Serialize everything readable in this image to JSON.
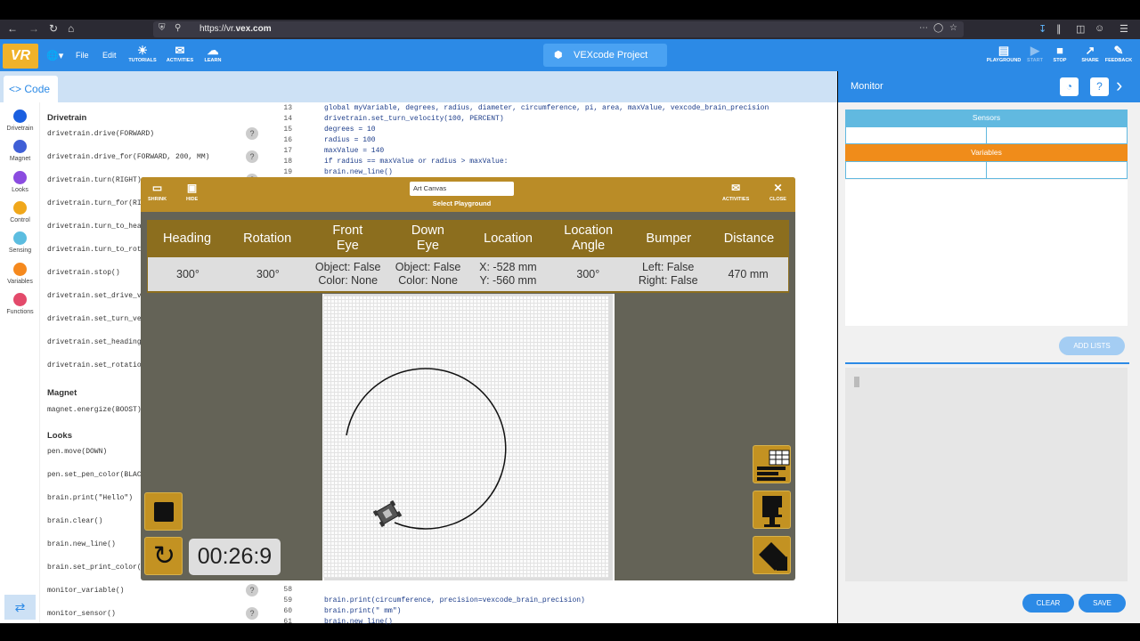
{
  "browser": {
    "url_prefix": "https://vr.",
    "url_domain": "vex.com"
  },
  "header": {
    "logo": "VR",
    "menu_file": "File",
    "menu_edit": "Edit",
    "tutorials": "TUTORIALS",
    "activities": "ACTIVITIES",
    "learn": "LEARN",
    "project_name": "VEXcode Project",
    "playground": "PLAYGROUND",
    "start": "START",
    "stop": "STOP",
    "share": "SHARE",
    "feedback": "FEEDBACK"
  },
  "code_tab": {
    "label": "Code"
  },
  "categories": [
    "Drivetrain",
    "Magnet",
    "Looks",
    "Control",
    "Sensing",
    "Variables",
    "Functions"
  ],
  "category_colors": [
    "#1a5fe0",
    "#3f5fd6",
    "#8b4ce0",
    "#f0a71b",
    "#5cbde0",
    "#f5891e",
    "#e34a6b"
  ],
  "blocks": {
    "drivetrain_title": "Drivetrain",
    "drivetrain": [
      "drivetrain.drive(FORWARD)",
      "drivetrain.drive_for(FORWARD, 200, MM)",
      "drivetrain.turn(RIGHT)",
      "drivetrain.turn_for(RI",
      "drivetrain.turn_to_hea",
      "drivetrain.turn_to_rot",
      "drivetrain.stop()",
      "drivetrain.set_drive_v",
      "drivetrain.set_turn_ve",
      "drivetrain.set_heading",
      "drivetrain.set_rotatio"
    ],
    "magnet_title": "Magnet",
    "magnet": [
      "magnet.energize(BOOST)"
    ],
    "looks_title": "Looks",
    "looks": [
      "pen.move(DOWN)",
      "pen.set_pen_color(BLAC",
      "brain.print(\"Hello\")",
      "brain.clear()",
      "brain.new_line()",
      "brain.set_print_color(",
      "monitor_variable()",
      "monitor_sensor()"
    ],
    "help": "?"
  },
  "editor": {
    "top_lines": [
      {
        "n": "13",
        "text": "global myVariable, degrees, radius, diameter, circumference, pi, area, maxValue, vexcode_brain_precision"
      },
      {
        "n": "14",
        "text": "drivetrain.set_turn_velocity(100, PERCENT)"
      },
      {
        "n": "15",
        "text": "degrees = 10"
      },
      {
        "n": "16",
        "text": "radius = 100"
      },
      {
        "n": "17",
        "text": "maxValue = 140"
      },
      {
        "n": "18",
        "text": "if radius == maxValue or radius > maxValue:"
      },
      {
        "n": "19",
        "text": "    brain.new_line()"
      }
    ],
    "bottom_lines": [
      {
        "n": "58",
        "text": ""
      },
      {
        "n": "59",
        "text": "        brain.print(circumference, precision=vexcode_brain_precision)"
      },
      {
        "n": "60",
        "text": "        brain.print(\" mm\")"
      },
      {
        "n": "61",
        "text": "        brain.new_line()"
      }
    ]
  },
  "monitor": {
    "title": "Monitor",
    "sensors": "Sensors",
    "variables": "Variables",
    "add_lists": "ADD LISTS",
    "clear": "CLEAR",
    "save": "SAVE"
  },
  "playground": {
    "shrink": "SHRINK",
    "hide": "HIDE",
    "selected": "Art Canvas",
    "select_label": "Select Playground",
    "activities": "ACTIVITIES",
    "close": "CLOSE",
    "dashboard": {
      "headers": [
        "Heading",
        "Rotation",
        "Front\nEye",
        "Down\nEye",
        "Location",
        "Location\nAngle",
        "Bumper",
        "Distance"
      ],
      "values": [
        "300°",
        "300°",
        "Object: False\nColor: None",
        "Object: False\nColor: None",
        "X: -528 mm\nY: -560 mm",
        "300°",
        "Left: False\nRight: False",
        "470 mm"
      ]
    },
    "timer": "00:26:9"
  }
}
